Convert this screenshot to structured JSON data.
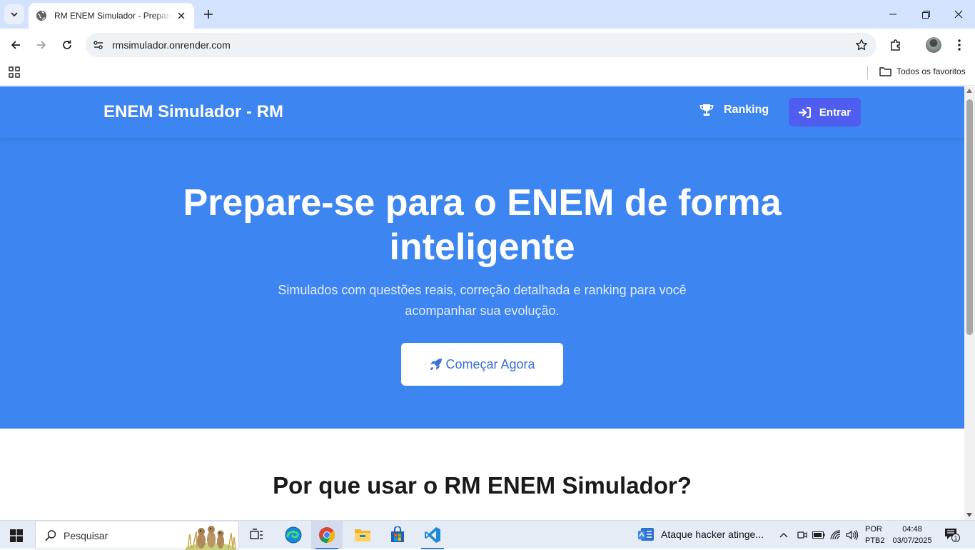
{
  "browser": {
    "tab_title": "RM ENEM Simulador - Prepare-se para o ENEM",
    "url": "rmsimulador.onrender.com",
    "bookmarks_all_label": "Todos os favoritos"
  },
  "site": {
    "brand": "ENEM Simulador - RM",
    "nav": {
      "ranking_label": "Ranking",
      "login_label": "Entrar"
    },
    "hero": {
      "title_line1": "Prepare-se para o ENEM de forma",
      "title_line2": "inteligente",
      "subtitle": "Simulados com questões reais, correção detalhada e ranking para você acompanhar sua evolução.",
      "cta_label": "Começar Agora"
    },
    "why_title": "Por que usar o RM ENEM Simulador?",
    "colors": {
      "primary": "#3d85f0",
      "login_button": "#4f5df0",
      "cta_text": "#3a6fd8"
    }
  },
  "taskbar": {
    "search_placeholder": "Pesquisar",
    "news_headline": "Ataque hacker atinge...",
    "language_line1": "POR",
    "language_line2": "PTB2",
    "time": "04:48",
    "date": "03/07/2025",
    "notification_count": "1",
    "apps": [
      "task-view",
      "edge",
      "chrome",
      "file-explorer",
      "store",
      "vscode"
    ]
  }
}
